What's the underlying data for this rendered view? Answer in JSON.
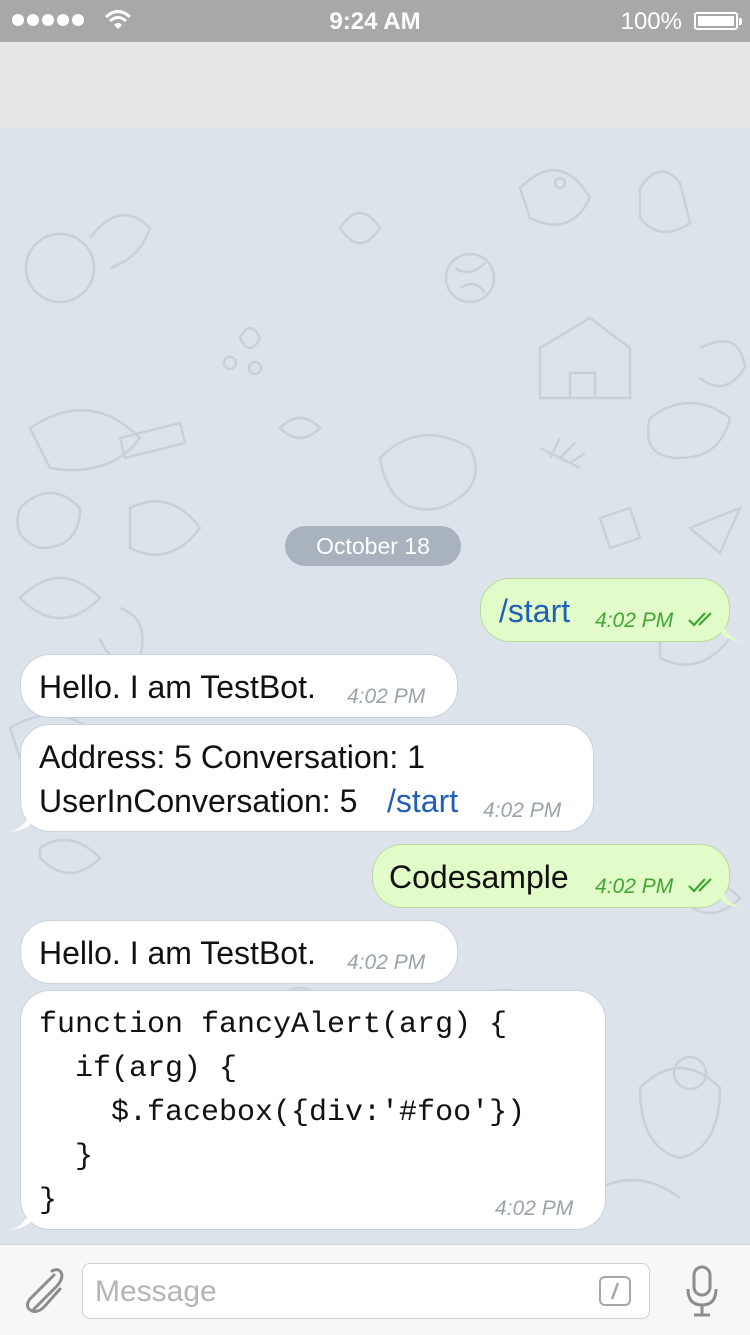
{
  "status_bar": {
    "time": "9:24 AM",
    "battery": "100%"
  },
  "chat": {
    "date_separator": "October 18",
    "messages": [
      {
        "direction": "outgoing",
        "parts": [
          {
            "text": "/start",
            "type": "command"
          }
        ],
        "time": "4:02 PM",
        "status": "read"
      },
      {
        "direction": "incoming",
        "parts": [
          {
            "text": "Hello. I am TestBot.",
            "type": "text"
          }
        ],
        "time": "4:02 PM"
      },
      {
        "direction": "incoming",
        "line1": "Address: 5 Conversation: 1",
        "line2": "UserInConversation: 5 ",
        "command": "/start",
        "time": "4:02 PM"
      },
      {
        "direction": "outgoing",
        "parts": [
          {
            "text": "Codesample",
            "type": "text"
          }
        ],
        "time": "4:02 PM",
        "status": "read"
      },
      {
        "direction": "incoming",
        "parts": [
          {
            "text": "Hello. I am TestBot.",
            "type": "text"
          }
        ],
        "time": "4:02 PM"
      },
      {
        "direction": "incoming",
        "type": "code",
        "code_lines": [
          "function fancyAlert(arg) {",
          "  if(arg) {",
          "    $.facebox({div:'#foo'})",
          "  }",
          "}"
        ],
        "time": "4:02 PM"
      }
    ]
  },
  "input_bar": {
    "placeholder": "Message",
    "attach_icon": "paperclip-icon",
    "command_icon": "slash-command-icon",
    "mic_icon": "microphone-icon"
  },
  "colors": {
    "outgoing_bubble": "#e2fcc9",
    "incoming_bubble": "#ffffff",
    "link": "#1f5fb5",
    "read_ticks": "#41a535"
  }
}
